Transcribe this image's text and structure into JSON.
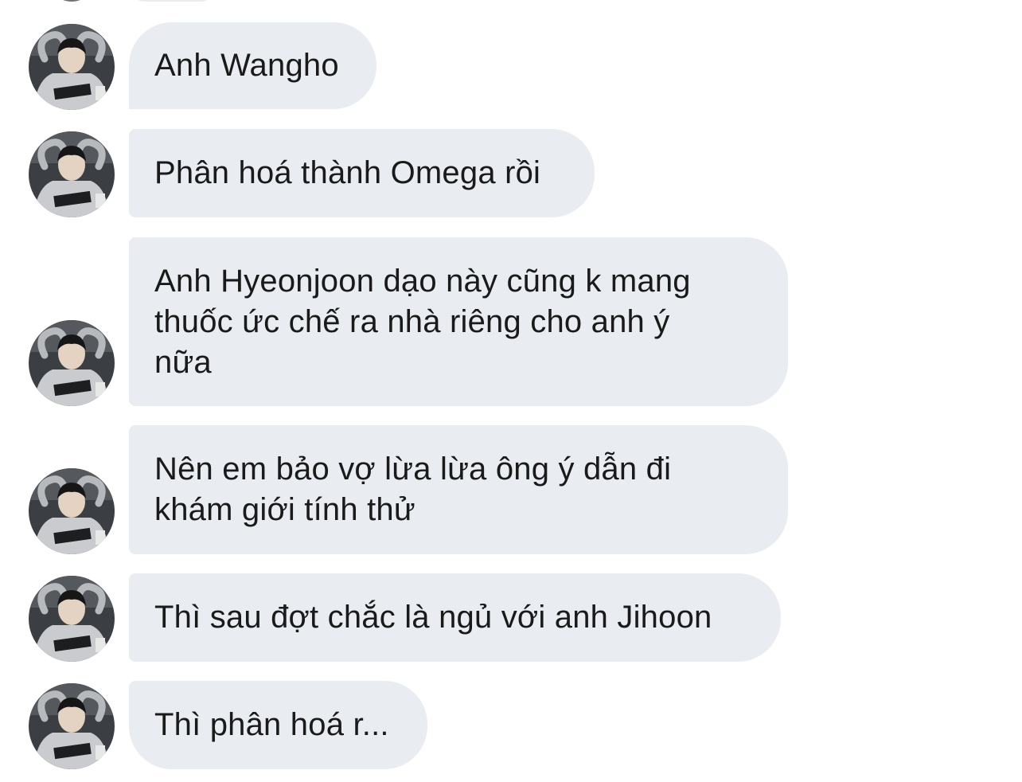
{
  "thread": {
    "messages": [
      {
        "text": "Anh Wangho",
        "avatar_icon": "profile-photo-icon"
      },
      {
        "text": "Phân hoá thành Omega rồi",
        "avatar_icon": "profile-photo-icon"
      },
      {
        "text": "Anh Hyeonjoon dạo này cũng k mang\nthuốc ức chế ra nhà riêng cho anh ý\nnữa",
        "avatar_icon": "profile-photo-icon"
      },
      {
        "text": "Nên em bảo vợ lừa lừa ông ý dẫn đi\nkhám giới tính thử",
        "avatar_icon": "profile-photo-icon"
      },
      {
        "text": "Thì sau đợt chắc là ngủ với anh Jihoon",
        "avatar_icon": "profile-photo-icon"
      },
      {
        "text": "Thì phân hoá r...",
        "avatar_icon": "profile-photo-icon"
      }
    ]
  },
  "colors": {
    "bubble_bg": "#e9ecf1",
    "text": "#1a1a1a",
    "background": "#ffffff"
  }
}
